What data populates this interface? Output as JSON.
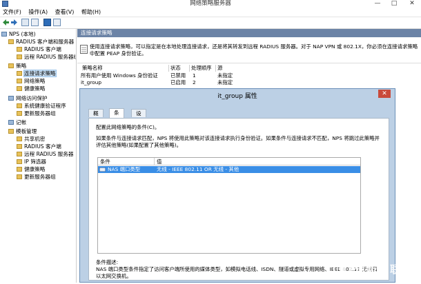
{
  "window": {
    "title": "网络策略服务器",
    "min": "—",
    "max": "□",
    "close": "✕"
  },
  "menu": [
    "文件(F)",
    "操作(A)",
    "查看(V)",
    "帮助(H)"
  ],
  "tree": {
    "root": "NPS (本地)",
    "radius_clients_servers": "RADIUS 客户端和服务器",
    "radius_clients": "RADIUS 客户端",
    "remote_radius_groups": "远程 RADIUS 服务器组",
    "policies": "策略",
    "connection_request_policies": "连接请求策略",
    "network_policies": "网络策略",
    "health_policies": "健康策略",
    "nap": "网络访问保护",
    "shv": "系统健康验证程序",
    "update_server_groups": "更新服务器组",
    "accounting": "记帐",
    "templates": "模板管理",
    "shared_secrets": "共享机密",
    "t_radius_clients": "RADIUS 客户端",
    "t_remote_radius": "远程 RADIUS 服务器",
    "ip_filters": "IP 筛选器",
    "t_health_policies": "健康策略",
    "t_update_server_groups": "更新服务器组"
  },
  "main": {
    "header": "连接请求策略",
    "description": "使用连接请求策略，可以指定是在本地处理连接请求，还是将其转发到远程 RADIUS 服务器。对于 NAP VPN 或 802.1X，你必须在连接请求策略中配置 PEAP 身份验证。",
    "columns": [
      "策略名称",
      "状态",
      "处理顺序",
      "源"
    ],
    "rows": [
      {
        "name": "所有用户使用 Windows 身份验证",
        "status": "已禁用",
        "order": "1",
        "source": "未指定"
      },
      {
        "name": "it_group",
        "status": "已启用",
        "order": "2",
        "source": "未指定"
      }
    ]
  },
  "dialog": {
    "title": "it_group 属性",
    "close": "✕",
    "tabs": [
      "概述",
      "条件",
      "设置"
    ],
    "active_tab": "条件",
    "intro": "配置此网络策略的条件(C)。",
    "explain": "如果条件与连接请求匹配，NPS 将使用此策略对该连接请求执行身份验证。如果条件与连接请求不匹配，NPS 将跳过此策略并评估其他策略(如果配置了其他策略)。",
    "cond_columns": [
      "条件",
      "值"
    ],
    "cond_rows": [
      {
        "condition": "NAS 端口类型",
        "value": "无线 - IEEE 802.11 OR 无线 - 其他"
      }
    ],
    "cond_desc_label": "条件描述:",
    "cond_desc": "NAS 端口类型条件指定了访问客户端所使用的媒体类型，如模拟电话线、ISDN、隧道或虚拟专用网络、IEEE 802.11 无线和以太网交换机。"
  },
  "watermark": {
    "text": "创新互联"
  }
}
